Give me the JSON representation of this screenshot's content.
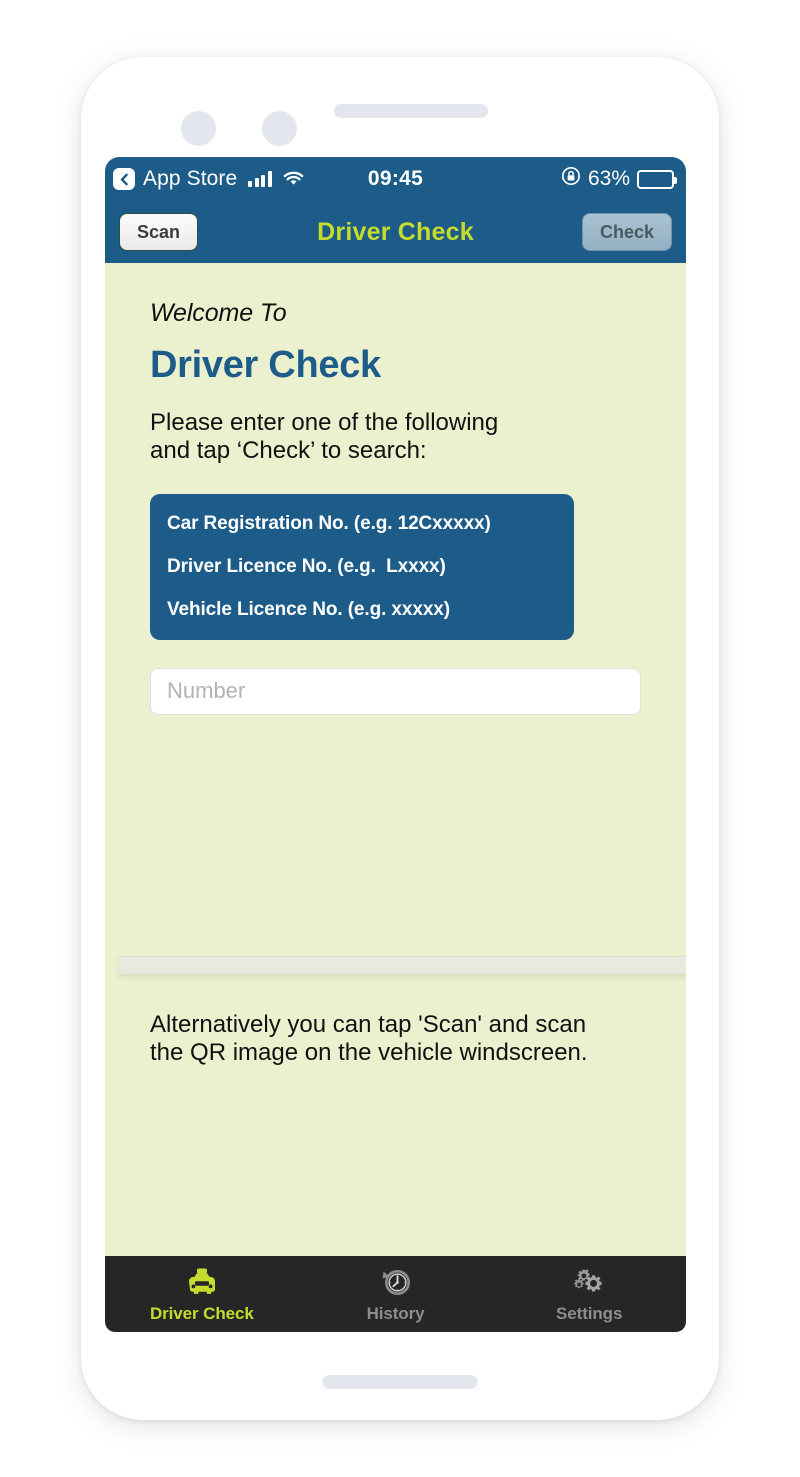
{
  "statusbar": {
    "back_icon": "chevron-left-icon",
    "app_name": "App Store",
    "signal_icon": "cellular-signal-icon",
    "wifi_icon": "wifi-icon",
    "time": "09:45",
    "rotation_lock_icon": "rotation-lock-icon",
    "battery_percent": "63%",
    "battery_level": 63
  },
  "navbar": {
    "scan_label": "Scan",
    "title": "Driver Check",
    "check_label": "Check"
  },
  "content": {
    "welcome_to": "Welcome To",
    "app_heading": "Driver Check",
    "instructions": "Please enter one of the following\nand tap ‘Check’ to search:",
    "info_lines": [
      "Car Registration No. (e.g. 12Cxxxxx)",
      "Driver Licence No. (e.g.  Lxxxx)",
      "Vehicle Licence No. (e.g. xxxxx)"
    ],
    "number_placeholder": "Number",
    "number_value": "",
    "alt_text": "Alternatively you can tap 'Scan' and scan\nthe QR image on the vehicle windscreen."
  },
  "tabbar": {
    "tabs": [
      {
        "label": "Driver Check",
        "icon": "taxi-icon",
        "active": true
      },
      {
        "label": "History",
        "icon": "clock-history-icon",
        "active": false
      },
      {
        "label": "Settings",
        "icon": "gears-icon",
        "active": false
      }
    ]
  },
  "colors": {
    "brand_blue": "#1d5c88",
    "accent_green": "#c6dc2c",
    "screen_bg": "#ebf0cf",
    "tabbar_bg": "#262626",
    "inactive_tab": "#8d8d8d"
  }
}
